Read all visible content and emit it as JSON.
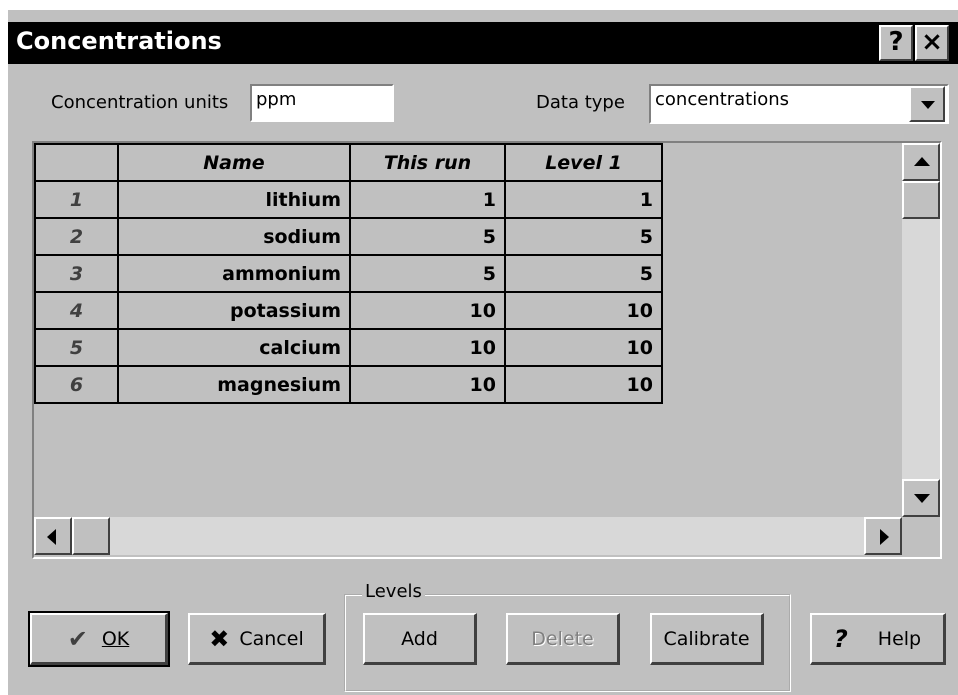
{
  "window": {
    "title": "Concentrations",
    "help_glyph": "?",
    "close_glyph": "×"
  },
  "units": {
    "label": "Concentration units",
    "value": "ppm"
  },
  "data_type": {
    "label": "Data type",
    "value": "concentrations"
  },
  "table": {
    "columns": [
      "",
      "Name",
      "This run",
      "Level 1"
    ],
    "rows": [
      {
        "num": "1",
        "name": "lithium",
        "this_run": "1",
        "level1": "1"
      },
      {
        "num": "2",
        "name": "sodium",
        "this_run": "5",
        "level1": "5"
      },
      {
        "num": "3",
        "name": "ammonium",
        "this_run": "5",
        "level1": "5"
      },
      {
        "num": "4",
        "name": "potassium",
        "this_run": "10",
        "level1": "10"
      },
      {
        "num": "5",
        "name": "calcium",
        "this_run": "10",
        "level1": "10"
      },
      {
        "num": "6",
        "name": "magnesium",
        "this_run": "10",
        "level1": "10"
      }
    ]
  },
  "buttons": {
    "ok": "OK",
    "cancel": "Cancel",
    "levels_group": "Levels",
    "add": "Add",
    "delete": "Delete",
    "calibrate": "Calibrate",
    "help": "Help",
    "help_glyph": "?"
  }
}
